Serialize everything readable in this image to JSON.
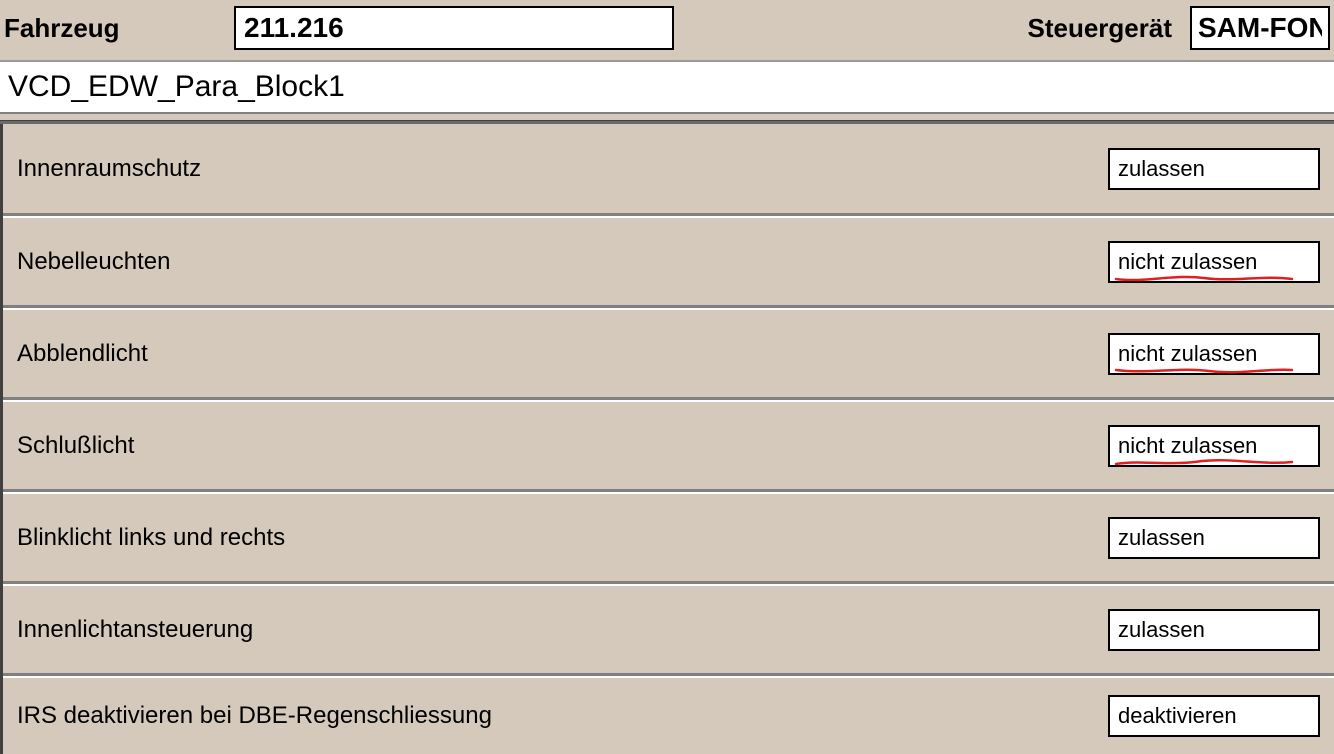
{
  "header": {
    "fahrzeug_label": "Fahrzeug",
    "fahrzeug_value": "211.216",
    "steuergeraet_label": "Steuergerät",
    "steuergeraet_value": "SAM-FON"
  },
  "block_title": "VCD_EDW_Para_Block1",
  "parameters": [
    {
      "label": "Innenraumschutz",
      "value": "zulassen",
      "marked": false
    },
    {
      "label": "Nebelleuchten",
      "value": "nicht zulassen",
      "marked": true
    },
    {
      "label": "Abblendlicht",
      "value": "nicht zulassen",
      "marked": true
    },
    {
      "label": "Schlußlicht",
      "value": "nicht zulassen",
      "marked": true
    },
    {
      "label": "Blinklicht links und rechts",
      "value": "zulassen",
      "marked": false
    },
    {
      "label": "Innenlichtansteuerung",
      "value": "zulassen",
      "marked": false
    },
    {
      "label": "IRS deaktivieren bei DBE-Regenschliessung",
      "value": "deaktivieren",
      "marked": false
    }
  ]
}
